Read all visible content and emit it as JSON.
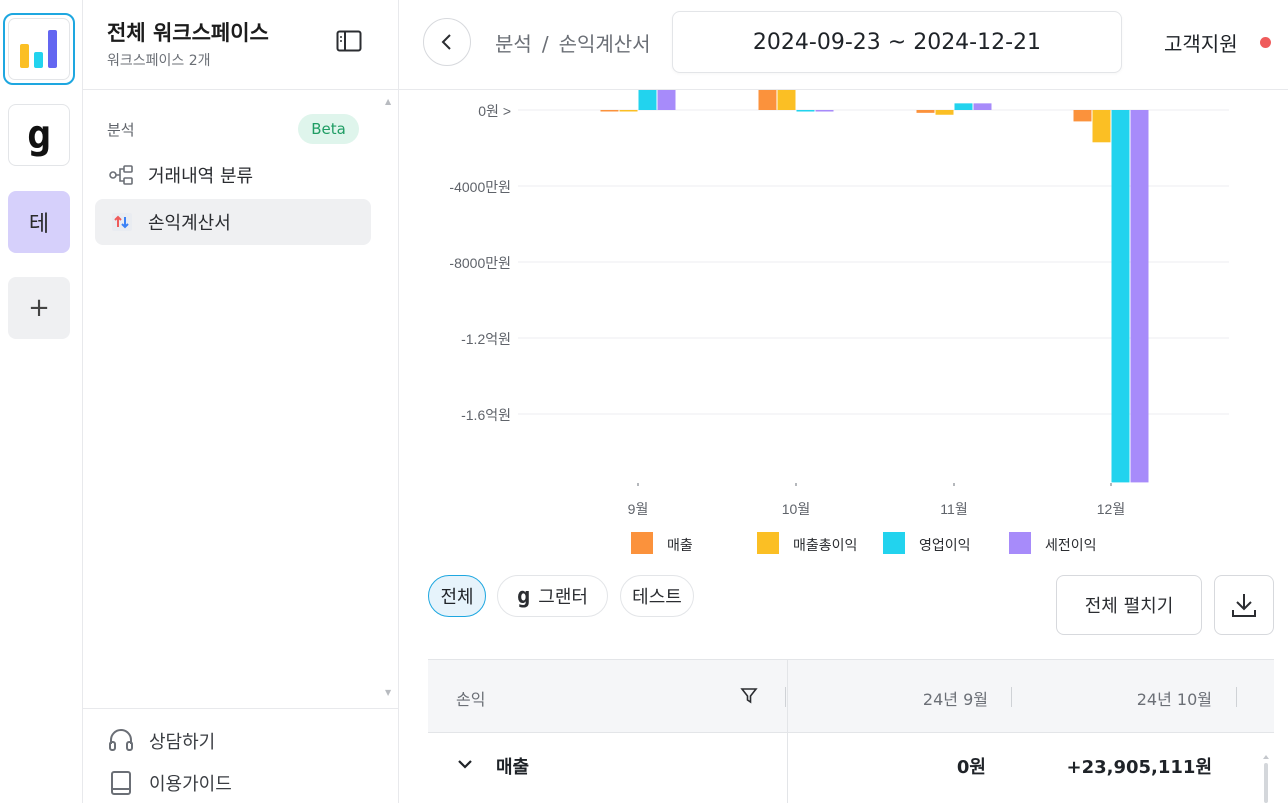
{
  "rail": {
    "workspace_initial": "테",
    "add_symbol": "+",
    "g_logo": "g"
  },
  "sidebar": {
    "title": "전체 워크스페이스",
    "subtitle": "워크스페이스 2개",
    "section_label": "분석",
    "beta_badge": "Beta",
    "items": [
      {
        "label": "거래내역 분류",
        "icon": "flow-icon"
      },
      {
        "label": "손익계산서",
        "icon": "income-statement-icon",
        "active": true
      }
    ],
    "footer": [
      {
        "label": "상담하기",
        "icon": "headset-icon"
      },
      {
        "label": "이용가이드",
        "icon": "book-icon"
      }
    ]
  },
  "header": {
    "breadcrumb": [
      "분석",
      "손익계산서"
    ],
    "breadcrumb_sep": "/",
    "date_range": "2024-09-23 ~ 2024-12-21",
    "support_label": "고객지원",
    "support_dot_color": "#ef5b5b"
  },
  "chart_data": {
    "type": "bar",
    "categories": [
      "9월",
      "10월",
      "11월",
      "12월"
    ],
    "series": [
      {
        "name": "매출",
        "color": "#fb923c",
        "values": [
          0,
          23905111,
          -1500000,
          -6000000
        ]
      },
      {
        "name": "매출총이익",
        "color": "#fbbf24",
        "values": [
          0,
          23905111,
          -2500000,
          -17000000
        ]
      },
      {
        "name": "영업이익",
        "color": "#22d3ee",
        "values": [
          23000000,
          -800000,
          3500000,
          -196000000
        ]
      },
      {
        "name": "세전이익",
        "color": "#a78bfa",
        "values": [
          23000000,
          -800000,
          3500000,
          -196000000
        ]
      }
    ],
    "ytick_labels": [
      "0원 >",
      "-4000만원",
      "-8000만원",
      "-1.2억원",
      "-1.6억원"
    ],
    "legend_position": "bottom",
    "grid": true
  },
  "filters": {
    "chips": [
      {
        "label": "전체",
        "active": true
      },
      {
        "label": "그랜터",
        "active": false
      },
      {
        "label": "테스트",
        "active": false
      }
    ],
    "grt_logo": "g",
    "expand_label": "전체 펼치기"
  },
  "table": {
    "columns": [
      "손익",
      "24년 9월",
      "24년 10월"
    ],
    "rows": [
      {
        "label": "매출",
        "values": [
          "0원",
          "+23,905,111원"
        ]
      }
    ]
  }
}
